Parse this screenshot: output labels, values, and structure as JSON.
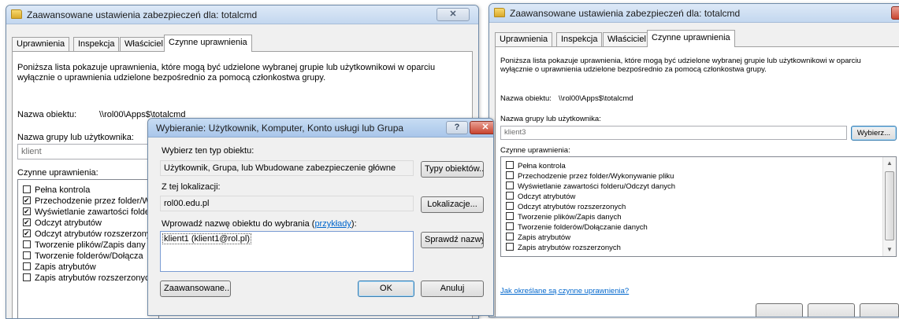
{
  "left_window": {
    "title": "Zaawansowane ustawienia zabezpieczeń dla: totalcmd",
    "close_glyph": "✕",
    "tabs": [
      "Uprawnienia",
      "Inspekcja",
      "Właściciel",
      "Czynne uprawnienia"
    ],
    "description": "Poniższa lista pokazuje uprawnienia, które mogą być udzielone wybranej grupie lub użytkownikowi w oparciu wyłącznie o uprawnienia udzielone bezpośrednio za pomocą członkostwa grupy.",
    "object_name_label": "Nazwa obiektu:",
    "object_name_value": "\\\\rol00\\Apps$\\totalcmd",
    "group_label": "Nazwa grupy lub użytkownika:",
    "group_value": "klient",
    "permissions_label": "Czynne uprawnienia:",
    "permissions": [
      {
        "label": "Pełna kontrola",
        "checked": false
      },
      {
        "label": "Przechodzenie przez folder/W",
        "checked": true
      },
      {
        "label": "Wyświetlanie zawartości folde",
        "checked": true
      },
      {
        "label": "Odczyt atrybutów",
        "checked": true
      },
      {
        "label": "Odczyt atrybutów rozszerzony",
        "checked": true
      },
      {
        "label": "Tworzenie plików/Zapis dany",
        "checked": false
      },
      {
        "label": "Tworzenie folderów/Dołącza",
        "checked": false
      },
      {
        "label": "Zapis atrybutów",
        "checked": false
      },
      {
        "label": "Zapis atrybutów rozszerzonyc",
        "checked": false
      }
    ]
  },
  "dialog": {
    "title": "Wybieranie: Użytkownik, Komputer, Konto usługi lub Grupa",
    "help_glyph": "?",
    "close_glyph": "✕",
    "object_type_label": "Wybierz ten typ obiektu:",
    "object_type_value": "Użytkownik, Grupa, lub Wbudowane zabezpieczenie główne",
    "object_types_button": "Typy obiektów...",
    "location_label": "Z tej lokalizacji:",
    "location_value": "rol00.edu.pl",
    "locations_button": "Lokalizacje...",
    "enter_label": "Wprowadź nazwę obiektu do wybrania (",
    "enter_link": "przykłady",
    "enter_suffix": "):",
    "entered_value": "klient1 (klient1@rol.pl)",
    "check_names_button": "Sprawdź nazwy",
    "advanced_button": "Zaawansowane...",
    "ok_button": "OK",
    "cancel_button": "Anuluj"
  },
  "right_window": {
    "title": "Zaawansowane ustawienia zabezpieczeń dla: totalcmd",
    "close_glyph": "✕",
    "tabs": [
      "Uprawnienia",
      "Inspekcja",
      "Właściciel",
      "Czynne uprawnienia"
    ],
    "description": "Poniższa lista pokazuje uprawnienia, które mogą być udzielone wybranej grupie lub użytkownikowi w oparciu wyłącznie o uprawnienia udzielone bezpośrednio za pomocą członkostwa grupy.",
    "object_name_label": "Nazwa obiektu:",
    "object_name_value": "\\\\rol00\\Apps$\\totalcmd",
    "group_label": "Nazwa grupy lub użytkownika:",
    "group_value": "klient3",
    "select_button": "Wybierz...",
    "permissions_label": "Czynne uprawnienia:",
    "permissions": [
      {
        "label": "Pełna kontrola",
        "checked": false
      },
      {
        "label": "Przechodzenie przez folder/Wykonywanie pliku",
        "checked": false
      },
      {
        "label": "Wyświetlanie zawartości folderu/Odczyt danych",
        "checked": false
      },
      {
        "label": "Odczyt atrybutów",
        "checked": false
      },
      {
        "label": "Odczyt atrybutów rozszerzonych",
        "checked": false
      },
      {
        "label": "Tworzenie plików/Zapis danych",
        "checked": false
      },
      {
        "label": "Tworzenie folderów/Dołączanie danych",
        "checked": false
      },
      {
        "label": "Zapis atrybutów",
        "checked": false
      },
      {
        "label": "Zapis atrybutów rozszerzonych",
        "checked": false
      }
    ],
    "help_link": "Jak określane są czynne uprawnienia?"
  },
  "colors": {
    "link": "#0066cc",
    "title_bar": "#c3d7ef",
    "close_button": "#c9442f"
  }
}
